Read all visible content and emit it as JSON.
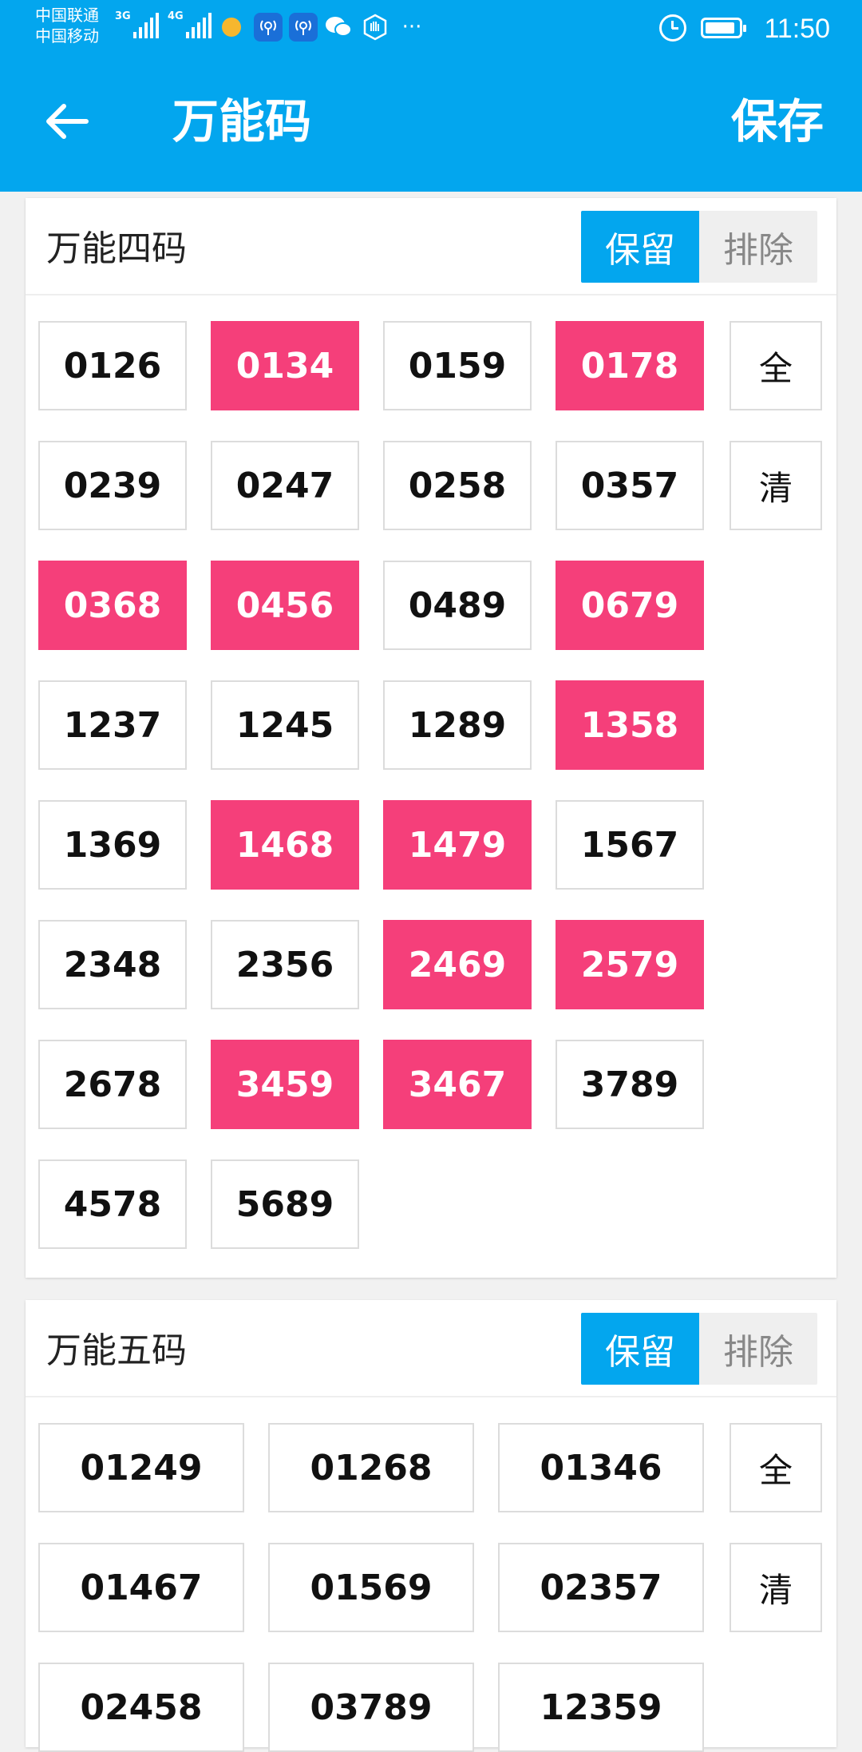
{
  "status_bar": {
    "carrier_1": "中国联通",
    "carrier_2": "中国移动",
    "net_1": "3G",
    "net_2": "4G",
    "more": "···",
    "time": "11:50",
    "icons": [
      "signal-icon",
      "signal-icon",
      "weather-sun-icon",
      "app-notification-icon",
      "app-notification-icon",
      "wechat-icon",
      "hand-icon",
      "more-icon",
      "alarm-icon",
      "battery-icon"
    ]
  },
  "app_bar": {
    "title": "万能码",
    "save_label": "保存"
  },
  "four_code": {
    "title": "万能四码",
    "keep_label": "保留",
    "exclude_label": "排除",
    "all_label": "全",
    "clear_label": "清",
    "codes": [
      {
        "code": "0126",
        "selected": false
      },
      {
        "code": "0134",
        "selected": true
      },
      {
        "code": "0159",
        "selected": false
      },
      {
        "code": "0178",
        "selected": true
      },
      {
        "code": "0239",
        "selected": false
      },
      {
        "code": "0247",
        "selected": false
      },
      {
        "code": "0258",
        "selected": false
      },
      {
        "code": "0357",
        "selected": false
      },
      {
        "code": "0368",
        "selected": true
      },
      {
        "code": "0456",
        "selected": true
      },
      {
        "code": "0489",
        "selected": false
      },
      {
        "code": "0679",
        "selected": true
      },
      {
        "code": "1237",
        "selected": false
      },
      {
        "code": "1245",
        "selected": false
      },
      {
        "code": "1289",
        "selected": false
      },
      {
        "code": "1358",
        "selected": true
      },
      {
        "code": "1369",
        "selected": false
      },
      {
        "code": "1468",
        "selected": true
      },
      {
        "code": "1479",
        "selected": true
      },
      {
        "code": "1567",
        "selected": false
      },
      {
        "code": "2348",
        "selected": false
      },
      {
        "code": "2356",
        "selected": false
      },
      {
        "code": "2469",
        "selected": true
      },
      {
        "code": "2579",
        "selected": true
      },
      {
        "code": "2678",
        "selected": false
      },
      {
        "code": "3459",
        "selected": true
      },
      {
        "code": "3467",
        "selected": true
      },
      {
        "code": "3789",
        "selected": false
      },
      {
        "code": "4578",
        "selected": false
      },
      {
        "code": "5689",
        "selected": false
      }
    ]
  },
  "five_code": {
    "title": "万能五码",
    "keep_label": "保留",
    "exclude_label": "排除",
    "all_label": "全",
    "clear_label": "清",
    "codes": [
      {
        "code": "01249",
        "selected": false
      },
      {
        "code": "01268",
        "selected": false
      },
      {
        "code": "01346",
        "selected": false
      },
      {
        "code": "01467",
        "selected": false
      },
      {
        "code": "01569",
        "selected": false
      },
      {
        "code": "02357",
        "selected": false
      },
      {
        "code": "02458",
        "selected": false
      },
      {
        "code": "03789",
        "selected": false
      },
      {
        "code": "12359",
        "selected": false
      }
    ]
  },
  "colors": {
    "primary": "#03a6ee",
    "selected": "#f53f7a",
    "border": "#dcdcdc",
    "background": "#f1f1f1"
  }
}
